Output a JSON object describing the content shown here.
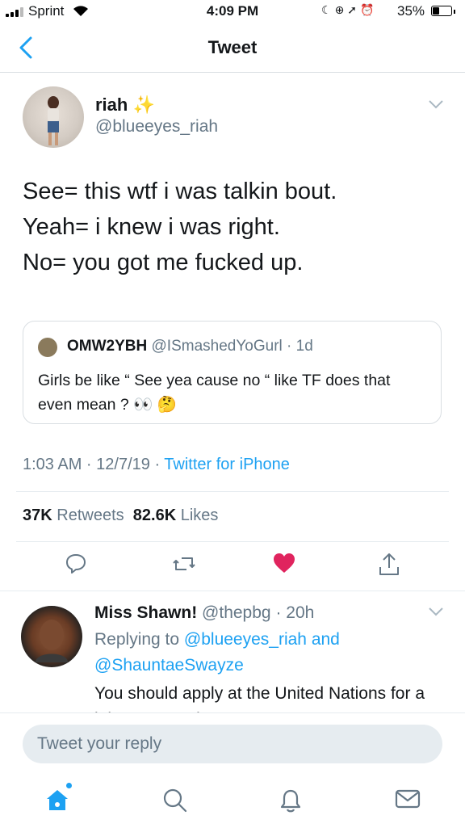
{
  "status_bar": {
    "carrier": "Sprint",
    "time": "4:09 PM",
    "battery_pct": "35%",
    "battery_level": 0.35,
    "icons": [
      "moon-icon",
      "screen-rotation-lock-icon",
      "location-icon",
      "alarm-icon"
    ]
  },
  "nav": {
    "title": "Tweet",
    "back_icon": "chevron-left-icon"
  },
  "tweet": {
    "name": "riah",
    "name_emoji": "✨",
    "handle": "@blueeyes_riah",
    "lines": [
      "See= this wtf i was talkin bout.",
      "Yeah= i knew i was right.",
      "No= you got me fucked up."
    ],
    "quoted": {
      "name": "OMW2YBH",
      "handle": "@ISmashedYoGurl",
      "time": "1d",
      "text": "Girls be like “ See yea cause no “ like TF does that even mean ? 👀 🤔"
    },
    "timestamp": "1:03 AM · 12/7/19 · ",
    "source": "Twitter for iPhone",
    "retweets_count": "37K",
    "retweets_label": "Retweets",
    "likes_count": "82.6K",
    "likes_label": "Likes",
    "like_color": "#e0245e"
  },
  "reply": {
    "name": "Miss Shawn!",
    "handle": "@thepbg",
    "time": "20h",
    "replying_prefix": "Replying to ",
    "replying_to_1": "@blueeyes_riah",
    "replying_and": " and",
    "replying_to_2": "@ShauntaeSwayze",
    "text": "You should apply at the United Nations for a job as a translator"
  },
  "compose": {
    "placeholder": "Tweet your reply"
  },
  "tabbar": {
    "icons": [
      "home-icon",
      "search-icon",
      "notifications-icon",
      "messages-icon"
    ]
  },
  "colors": {
    "accent": "#1da1f2",
    "secondary_text": "#657786"
  }
}
